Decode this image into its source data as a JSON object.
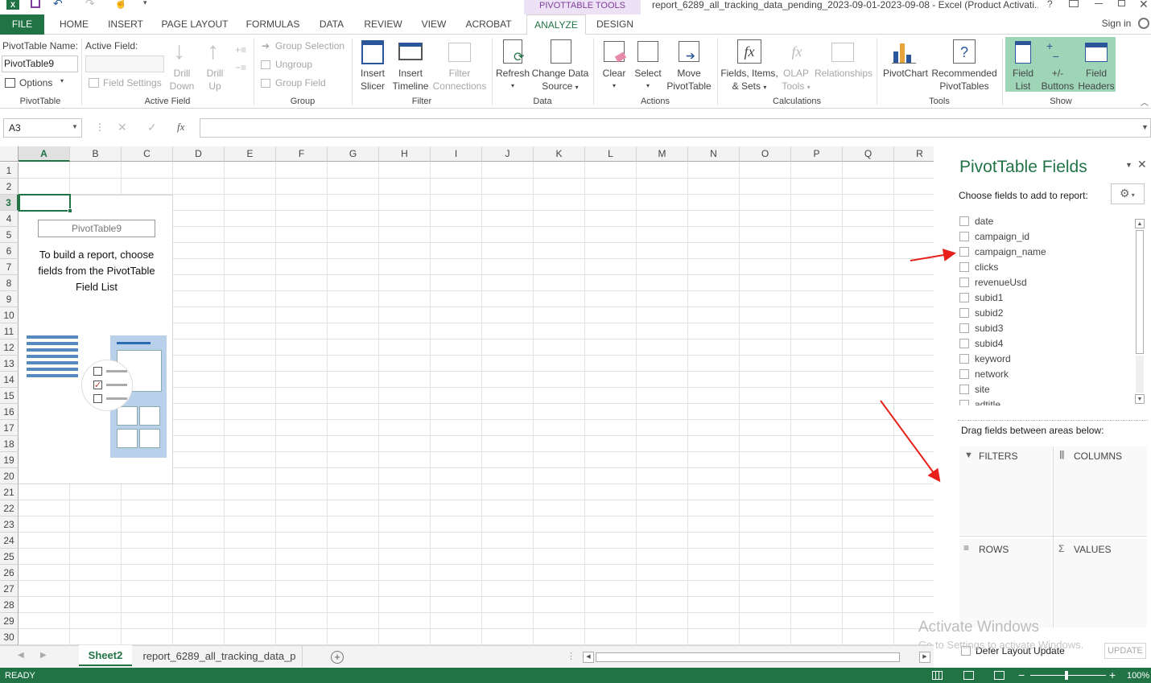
{
  "title_bar": {
    "document_title": "report_6289_all_tracking_data_pending_2023-09-01-2023-09-08 - Excel (Product Activati...",
    "help": "?",
    "context_tools_label": "PIVOTTABLE TOOLS"
  },
  "tabs": {
    "file": "FILE",
    "home": "HOME",
    "insert": "INSERT",
    "page_layout": "PAGE LAYOUT",
    "formulas": "FORMULAS",
    "data": "DATA",
    "review": "REVIEW",
    "view": "VIEW",
    "acrobat": "ACROBAT",
    "analyze": "ANALYZE",
    "design": "DESIGN",
    "sign_in": "Sign in"
  },
  "ribbon": {
    "pivottable": {
      "name_label": "PivotTable Name:",
      "name_value": "PivotTable9",
      "options": "Options",
      "group": "PivotTable"
    },
    "active_field": {
      "label": "Active Field:",
      "field_settings": "Field Settings",
      "drill_down_1": "Drill",
      "drill_down_2": "Down",
      "drill_up_1": "Drill",
      "drill_up_2": "Up",
      "group": "Active Field"
    },
    "group_grp": {
      "group_selection": "Group Selection",
      "ungroup": "Ungroup",
      "group_field": "Group Field",
      "group": "Group"
    },
    "filter": {
      "insert_slicer_1": "Insert",
      "insert_slicer_2": "Slicer",
      "insert_timeline_1": "Insert",
      "insert_timeline_2": "Timeline",
      "filter_conn_1": "Filter",
      "filter_conn_2": "Connections",
      "group": "Filter"
    },
    "data": {
      "refresh": "Refresh",
      "change_1": "Change Data",
      "change_2": "Source",
      "group": "Data"
    },
    "actions": {
      "clear": "Clear",
      "select": "Select",
      "move_1": "Move",
      "move_2": "PivotTable",
      "group": "Actions"
    },
    "calculations": {
      "fields_1": "Fields, Items,",
      "fields_2": "& Sets",
      "olap_1": "OLAP",
      "olap_2": "Tools",
      "relationships": "Relationships",
      "group": "Calculations"
    },
    "tools": {
      "pivotchart": "PivotChart",
      "recommended_1": "Recommended",
      "recommended_2": "PivotTables",
      "group": "Tools"
    },
    "show": {
      "field_list_1": "Field",
      "field_list_2": "List",
      "buttons_1": "+/-",
      "buttons_2": "Buttons",
      "headers_1": "Field",
      "headers_2": "Headers",
      "group": "Show"
    }
  },
  "formula_bar": {
    "name_box": "A3",
    "fx": "fx",
    "value": ""
  },
  "sheet": {
    "columns": [
      "A",
      "B",
      "C",
      "D",
      "E",
      "F",
      "G",
      "H",
      "I",
      "J",
      "K",
      "L",
      "M",
      "N",
      "O",
      "P",
      "Q",
      "R"
    ],
    "rows": [
      "1",
      "2",
      "3",
      "4",
      "5",
      "6",
      "7",
      "8",
      "9",
      "10",
      "11",
      "12",
      "13",
      "14",
      "15",
      "16",
      "17",
      "18",
      "19",
      "20",
      "21",
      "22",
      "23",
      "24",
      "25",
      "26",
      "27",
      "28",
      "29",
      "30"
    ],
    "selected_cell": "A3",
    "pivot_placeholder": {
      "name": "PivotTable9",
      "instructions": "To build a report, choose fields from the PivotTable Field List"
    }
  },
  "field_panel": {
    "title": "PivotTable Fields",
    "choose_label": "Choose fields to add to report:",
    "fields": [
      "date",
      "campaign_id",
      "campaign_name",
      "clicks",
      "revenueUsd",
      "subid1",
      "subid2",
      "subid3",
      "subid4",
      "keyword",
      "network",
      "site",
      "adtitle"
    ],
    "drag_label": "Drag fields between areas below:",
    "areas": {
      "filters": "FILTERS",
      "columns": "COLUMNS",
      "rows": "ROWS",
      "values": "VALUES"
    },
    "defer_label": "Defer Layout Update",
    "update_button": "UPDATE"
  },
  "watermark": {
    "line1": "Activate Windows",
    "line2": "Go to Settings to activate Windows."
  },
  "sheet_tabs": {
    "tabs": [
      "Sheet2",
      "report_6289_all_tracking_data_p"
    ],
    "active": "Sheet2"
  },
  "status_bar": {
    "ready": "READY",
    "zoom": "100%"
  },
  "colors": {
    "excel_green": "#217346",
    "context_purple": "#7e3d9a",
    "annotation_red": "#e8201b",
    "show_group_highlight": "#9fd5b7"
  }
}
